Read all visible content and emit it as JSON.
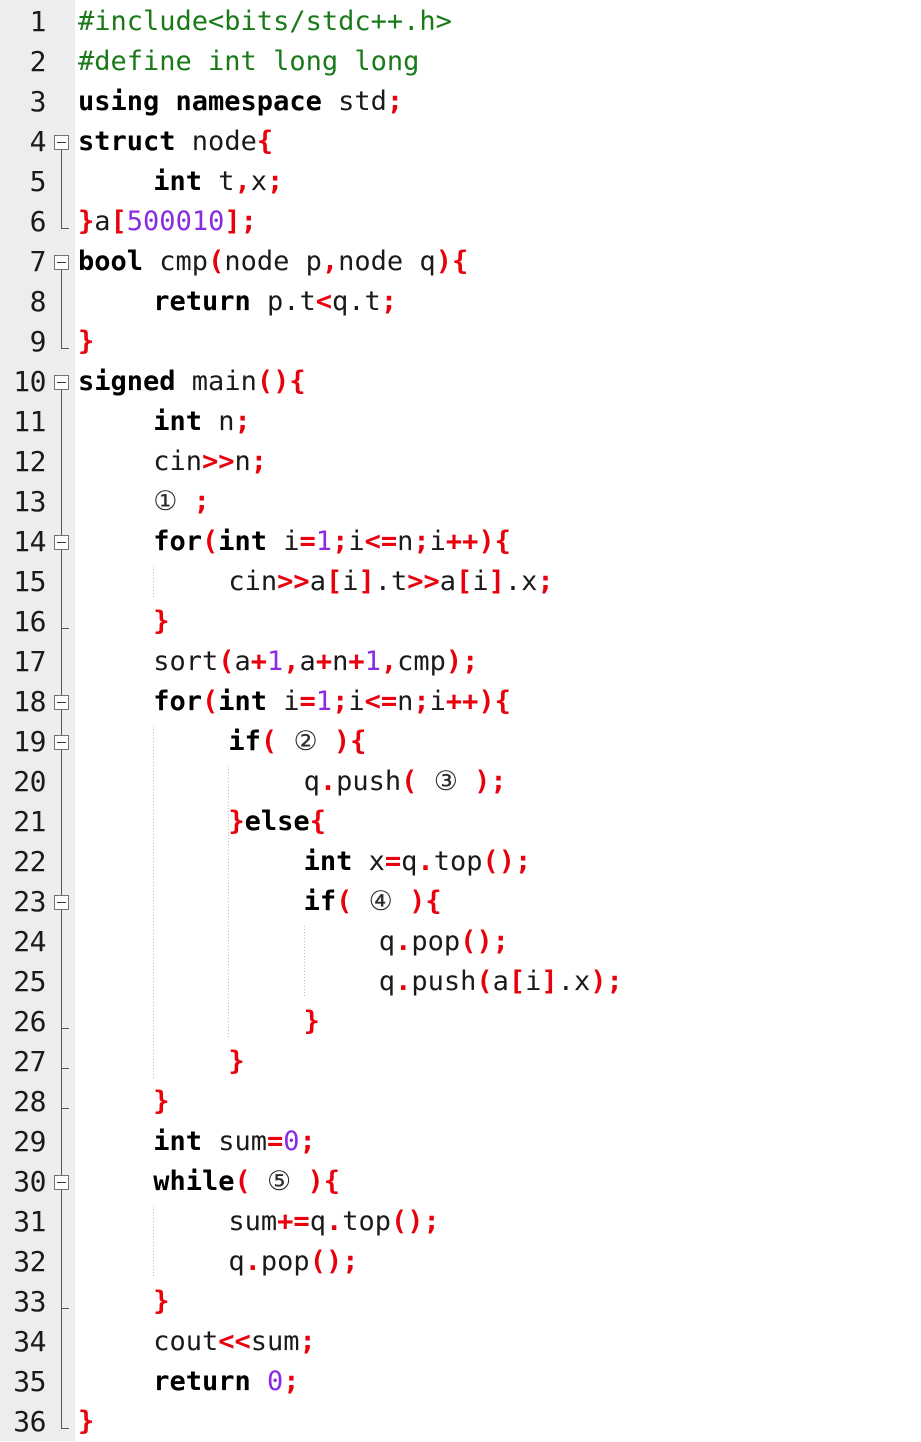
{
  "editor": {
    "language": "C++",
    "total_lines": 36,
    "gutter_bg": "#ededed",
    "editor_bg": "#ffffff",
    "colors": {
      "preprocessor": "#1a7a1a",
      "keyword": "#000000",
      "punctuation": "#e8000d",
      "number": "#8a2be2",
      "identifier": "#1a1a1a",
      "linenumber": "#1a1a1a",
      "fold_marker": "#737373",
      "indent_guide": "#bdbdbd"
    }
  },
  "lines": [
    {
      "n": "1",
      "indent": 0,
      "fold": "none",
      "tokens": [
        {
          "t": "pre",
          "v": "#include<bits/stdc++.h>"
        }
      ]
    },
    {
      "n": "2",
      "indent": 0,
      "fold": "none",
      "tokens": [
        {
          "t": "pre",
          "v": "#define int long long"
        }
      ]
    },
    {
      "n": "3",
      "indent": 0,
      "fold": "none",
      "tokens": [
        {
          "t": "kw",
          "v": "using namespace"
        },
        {
          "t": "id",
          "v": " std"
        },
        {
          "t": "pun",
          "v": ";"
        }
      ]
    },
    {
      "n": "4",
      "indent": 0,
      "fold": "open",
      "tokens": [
        {
          "t": "kw",
          "v": "struct"
        },
        {
          "t": "id",
          "v": " node"
        },
        {
          "t": "pun",
          "v": "{"
        }
      ]
    },
    {
      "n": "5",
      "indent": 1,
      "fold": "none",
      "tokens": [
        {
          "t": "kw",
          "v": "int"
        },
        {
          "t": "id",
          "v": " t"
        },
        {
          "t": "pun",
          "v": ","
        },
        {
          "t": "id",
          "v": "x"
        },
        {
          "t": "pun",
          "v": ";"
        }
      ]
    },
    {
      "n": "6",
      "indent": 0,
      "fold": "close",
      "tokens": [
        {
          "t": "pun",
          "v": "}"
        },
        {
          "t": "id",
          "v": "a"
        },
        {
          "t": "pun",
          "v": "["
        },
        {
          "t": "num",
          "v": "500010"
        },
        {
          "t": "pun",
          "v": "];"
        }
      ]
    },
    {
      "n": "7",
      "indent": 0,
      "fold": "open",
      "tokens": [
        {
          "t": "kw",
          "v": "bool"
        },
        {
          "t": "id",
          "v": " cmp"
        },
        {
          "t": "pun",
          "v": "("
        },
        {
          "t": "id",
          "v": "node p"
        },
        {
          "t": "pun",
          "v": ","
        },
        {
          "t": "id",
          "v": "node q"
        },
        {
          "t": "pun",
          "v": "){"
        }
      ]
    },
    {
      "n": "8",
      "indent": 1,
      "fold": "none",
      "tokens": [
        {
          "t": "kw",
          "v": "return"
        },
        {
          "t": "id",
          "v": " p.t"
        },
        {
          "t": "pun",
          "v": "<"
        },
        {
          "t": "id",
          "v": "q.t"
        },
        {
          "t": "pun",
          "v": ";"
        }
      ]
    },
    {
      "n": "9",
      "indent": 0,
      "fold": "close",
      "tokens": [
        {
          "t": "pun",
          "v": "}"
        }
      ]
    },
    {
      "n": "10",
      "indent": 0,
      "fold": "open",
      "tokens": [
        {
          "t": "kw",
          "v": "signed"
        },
        {
          "t": "id",
          "v": " main"
        },
        {
          "t": "pun",
          "v": "(){"
        }
      ]
    },
    {
      "n": "11",
      "indent": 1,
      "fold": "none",
      "tokens": [
        {
          "t": "kw",
          "v": "int"
        },
        {
          "t": "id",
          "v": " n"
        },
        {
          "t": "pun",
          "v": ";"
        }
      ]
    },
    {
      "n": "12",
      "indent": 1,
      "fold": "none",
      "tokens": [
        {
          "t": "id",
          "v": "cin"
        },
        {
          "t": "pun",
          "v": ">>"
        },
        {
          "t": "id",
          "v": "n"
        },
        {
          "t": "pun",
          "v": ";"
        }
      ]
    },
    {
      "n": "13",
      "indent": 1,
      "fold": "none",
      "tokens": [
        {
          "t": "ph",
          "v": "①"
        },
        {
          "t": "id",
          "v": " "
        },
        {
          "t": "pun",
          "v": ";"
        }
      ]
    },
    {
      "n": "14",
      "indent": 1,
      "fold": "open",
      "tokens": [
        {
          "t": "kw",
          "v": "for"
        },
        {
          "t": "pun",
          "v": "("
        },
        {
          "t": "kw",
          "v": "int"
        },
        {
          "t": "id",
          "v": " i"
        },
        {
          "t": "pun",
          "v": "="
        },
        {
          "t": "num",
          "v": "1"
        },
        {
          "t": "pun",
          "v": ";"
        },
        {
          "t": "id",
          "v": "i"
        },
        {
          "t": "pun",
          "v": "<="
        },
        {
          "t": "id",
          "v": "n"
        },
        {
          "t": "pun",
          "v": ";"
        },
        {
          "t": "id",
          "v": "i"
        },
        {
          "t": "pun",
          "v": "++){"
        }
      ]
    },
    {
      "n": "15",
      "indent": 2,
      "fold": "none",
      "tokens": [
        {
          "t": "id",
          "v": "cin"
        },
        {
          "t": "pun",
          "v": ">>"
        },
        {
          "t": "id",
          "v": "a"
        },
        {
          "t": "pun",
          "v": "["
        },
        {
          "t": "id",
          "v": "i"
        },
        {
          "t": "pun",
          "v": "]"
        },
        {
          "t": "id",
          "v": ".t"
        },
        {
          "t": "pun",
          "v": ">>"
        },
        {
          "t": "id",
          "v": "a"
        },
        {
          "t": "pun",
          "v": "["
        },
        {
          "t": "id",
          "v": "i"
        },
        {
          "t": "pun",
          "v": "]"
        },
        {
          "t": "id",
          "v": ".x"
        },
        {
          "t": "pun",
          "v": ";"
        }
      ]
    },
    {
      "n": "16",
      "indent": 1,
      "fold": "close",
      "tokens": [
        {
          "t": "pun",
          "v": "}"
        }
      ]
    },
    {
      "n": "17",
      "indent": 1,
      "fold": "none",
      "tokens": [
        {
          "t": "id",
          "v": "sort"
        },
        {
          "t": "pun",
          "v": "("
        },
        {
          "t": "id",
          "v": "a"
        },
        {
          "t": "pun",
          "v": "+"
        },
        {
          "t": "num",
          "v": "1"
        },
        {
          "t": "pun",
          "v": ","
        },
        {
          "t": "id",
          "v": "a"
        },
        {
          "t": "pun",
          "v": "+"
        },
        {
          "t": "id",
          "v": "n"
        },
        {
          "t": "pun",
          "v": "+"
        },
        {
          "t": "num",
          "v": "1"
        },
        {
          "t": "pun",
          "v": ","
        },
        {
          "t": "id",
          "v": "cmp"
        },
        {
          "t": "pun",
          "v": ");"
        }
      ]
    },
    {
      "n": "18",
      "indent": 1,
      "fold": "open",
      "tokens": [
        {
          "t": "kw",
          "v": "for"
        },
        {
          "t": "pun",
          "v": "("
        },
        {
          "t": "kw",
          "v": "int"
        },
        {
          "t": "id",
          "v": " i"
        },
        {
          "t": "pun",
          "v": "="
        },
        {
          "t": "num",
          "v": "1"
        },
        {
          "t": "pun",
          "v": ";"
        },
        {
          "t": "id",
          "v": "i"
        },
        {
          "t": "pun",
          "v": "<="
        },
        {
          "t": "id",
          "v": "n"
        },
        {
          "t": "pun",
          "v": ";"
        },
        {
          "t": "id",
          "v": "i"
        },
        {
          "t": "pun",
          "v": "++){"
        }
      ]
    },
    {
      "n": "19",
      "indent": 2,
      "fold": "open",
      "tokens": [
        {
          "t": "kw",
          "v": "if"
        },
        {
          "t": "pun",
          "v": "("
        },
        {
          "t": "id",
          "v": " "
        },
        {
          "t": "ph",
          "v": "②"
        },
        {
          "t": "id",
          "v": " "
        },
        {
          "t": "pun",
          "v": "){"
        }
      ]
    },
    {
      "n": "20",
      "indent": 3,
      "fold": "none",
      "tokens": [
        {
          "t": "id",
          "v": "q"
        },
        {
          "t": "pun",
          "v": "."
        },
        {
          "t": "id",
          "v": "push"
        },
        {
          "t": "pun",
          "v": "("
        },
        {
          "t": "id",
          "v": " "
        },
        {
          "t": "ph",
          "v": "③"
        },
        {
          "t": "id",
          "v": " "
        },
        {
          "t": "pun",
          "v": ");"
        }
      ]
    },
    {
      "n": "21",
      "indent": 2,
      "fold": "none",
      "tokens": [
        {
          "t": "pun",
          "v": "}"
        },
        {
          "t": "kw",
          "v": "else"
        },
        {
          "t": "pun",
          "v": "{"
        }
      ]
    },
    {
      "n": "22",
      "indent": 3,
      "fold": "none",
      "tokens": [
        {
          "t": "kw",
          "v": "int"
        },
        {
          "t": "id",
          "v": " x"
        },
        {
          "t": "pun",
          "v": "="
        },
        {
          "t": "id",
          "v": "q"
        },
        {
          "t": "pun",
          "v": "."
        },
        {
          "t": "id",
          "v": "top"
        },
        {
          "t": "pun",
          "v": "();"
        }
      ]
    },
    {
      "n": "23",
      "indent": 3,
      "fold": "open",
      "tokens": [
        {
          "t": "kw",
          "v": "if"
        },
        {
          "t": "pun",
          "v": "("
        },
        {
          "t": "id",
          "v": " "
        },
        {
          "t": "ph",
          "v": "④"
        },
        {
          "t": "id",
          "v": " "
        },
        {
          "t": "pun",
          "v": "){"
        }
      ]
    },
    {
      "n": "24",
      "indent": 4,
      "fold": "none",
      "tokens": [
        {
          "t": "id",
          "v": "q"
        },
        {
          "t": "pun",
          "v": "."
        },
        {
          "t": "id",
          "v": "pop"
        },
        {
          "t": "pun",
          "v": "();"
        }
      ]
    },
    {
      "n": "25",
      "indent": 4,
      "fold": "none",
      "tokens": [
        {
          "t": "id",
          "v": "q"
        },
        {
          "t": "pun",
          "v": "."
        },
        {
          "t": "id",
          "v": "push"
        },
        {
          "t": "pun",
          "v": "("
        },
        {
          "t": "id",
          "v": "a"
        },
        {
          "t": "pun",
          "v": "["
        },
        {
          "t": "id",
          "v": "i"
        },
        {
          "t": "pun",
          "v": "]"
        },
        {
          "t": "id",
          "v": ".x"
        },
        {
          "t": "pun",
          "v": ");"
        }
      ]
    },
    {
      "n": "26",
      "indent": 3,
      "fold": "close",
      "tokens": [
        {
          "t": "pun",
          "v": "}"
        }
      ]
    },
    {
      "n": "27",
      "indent": 2,
      "fold": "close",
      "tokens": [
        {
          "t": "pun",
          "v": "}"
        }
      ]
    },
    {
      "n": "28",
      "indent": 1,
      "fold": "close",
      "tokens": [
        {
          "t": "pun",
          "v": "}"
        }
      ]
    },
    {
      "n": "29",
      "indent": 1,
      "fold": "none",
      "tokens": [
        {
          "t": "kw",
          "v": "int"
        },
        {
          "t": "id",
          "v": " sum"
        },
        {
          "t": "pun",
          "v": "="
        },
        {
          "t": "num",
          "v": "0"
        },
        {
          "t": "pun",
          "v": ";"
        }
      ]
    },
    {
      "n": "30",
      "indent": 1,
      "fold": "open",
      "tokens": [
        {
          "t": "kw",
          "v": "while"
        },
        {
          "t": "pun",
          "v": "("
        },
        {
          "t": "id",
          "v": " "
        },
        {
          "t": "ph",
          "v": "⑤"
        },
        {
          "t": "id",
          "v": " "
        },
        {
          "t": "pun",
          "v": "){"
        }
      ]
    },
    {
      "n": "31",
      "indent": 2,
      "fold": "none",
      "tokens": [
        {
          "t": "id",
          "v": "sum"
        },
        {
          "t": "pun",
          "v": "+="
        },
        {
          "t": "id",
          "v": "q"
        },
        {
          "t": "pun",
          "v": "."
        },
        {
          "t": "id",
          "v": "top"
        },
        {
          "t": "pun",
          "v": "();"
        }
      ]
    },
    {
      "n": "32",
      "indent": 2,
      "fold": "none",
      "tokens": [
        {
          "t": "id",
          "v": "q"
        },
        {
          "t": "pun",
          "v": "."
        },
        {
          "t": "id",
          "v": "pop"
        },
        {
          "t": "pun",
          "v": "();"
        }
      ]
    },
    {
      "n": "33",
      "indent": 1,
      "fold": "close",
      "tokens": [
        {
          "t": "pun",
          "v": "}"
        }
      ]
    },
    {
      "n": "34",
      "indent": 1,
      "fold": "none",
      "tokens": [
        {
          "t": "id",
          "v": "cout"
        },
        {
          "t": "pun",
          "v": "<<"
        },
        {
          "t": "id",
          "v": "sum"
        },
        {
          "t": "pun",
          "v": ";"
        }
      ]
    },
    {
      "n": "35",
      "indent": 1,
      "fold": "none",
      "tokens": [
        {
          "t": "kw",
          "v": "return"
        },
        {
          "t": "id",
          "v": " "
        },
        {
          "t": "num",
          "v": "0"
        },
        {
          "t": "pun",
          "v": ";"
        }
      ]
    },
    {
      "n": "36",
      "indent": 0,
      "fold": "close",
      "tokens": [
        {
          "t": "pun",
          "v": "}"
        }
      ]
    }
  ],
  "fold_regions": [
    {
      "start": 4,
      "end": 6,
      "level": 0
    },
    {
      "start": 7,
      "end": 9,
      "level": 0
    },
    {
      "start": 10,
      "end": 36,
      "level": 0
    },
    {
      "start": 14,
      "end": 16,
      "level": 1
    },
    {
      "start": 18,
      "end": 28,
      "level": 1
    },
    {
      "start": 19,
      "end": 27,
      "level": 2
    },
    {
      "start": 23,
      "end": 26,
      "level": 3
    },
    {
      "start": 30,
      "end": 33,
      "level": 1
    }
  ],
  "indent_guides": [
    {
      "col": 1,
      "from": 15,
      "to": 15
    },
    {
      "col": 1,
      "from": 19,
      "to": 27
    },
    {
      "col": 2,
      "from": 20,
      "to": 26
    },
    {
      "col": 3,
      "from": 24,
      "to": 25
    },
    {
      "col": 1,
      "from": 31,
      "to": 32
    }
  ],
  "placeholders": [
    {
      "symbol": "①",
      "line": 13
    },
    {
      "symbol": "②",
      "line": 19
    },
    {
      "symbol": "③",
      "line": 20
    },
    {
      "symbol": "④",
      "line": 23
    },
    {
      "symbol": "⑤",
      "line": 30
    }
  ]
}
